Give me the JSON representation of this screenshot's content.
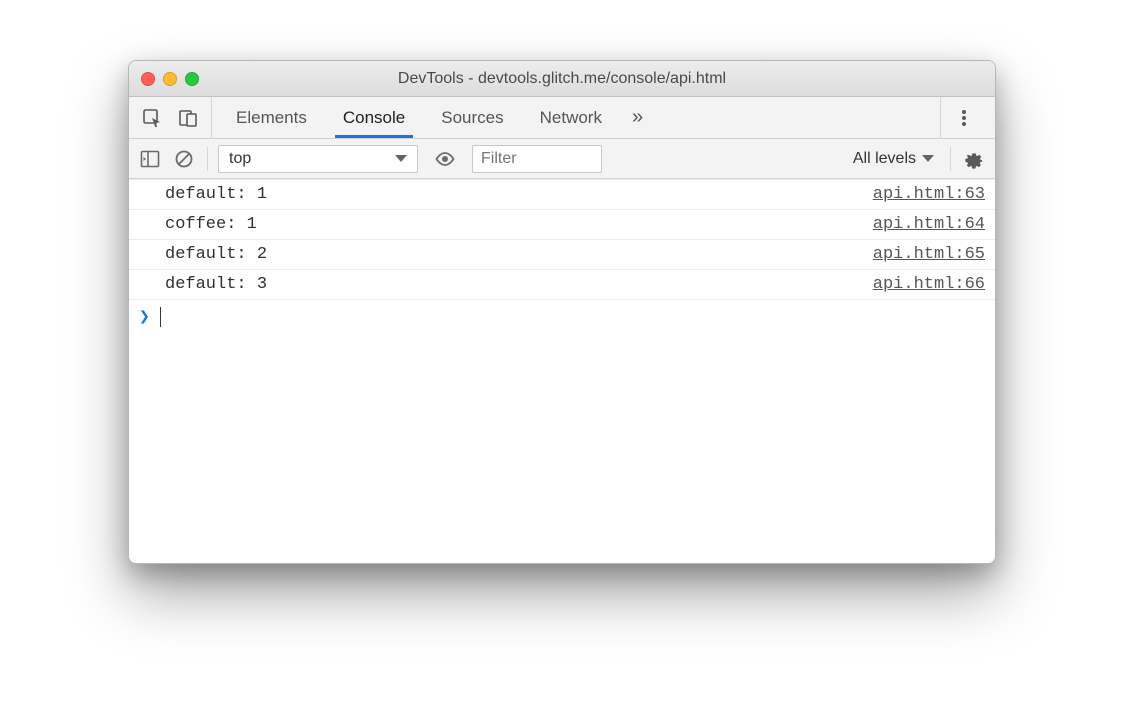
{
  "window": {
    "title": "DevTools - devtools.glitch.me/console/api.html"
  },
  "tabs": {
    "items": [
      "Elements",
      "Console",
      "Sources",
      "Network"
    ],
    "active_index": 1,
    "overflow_glyph": "»"
  },
  "console_toolbar": {
    "context": "top",
    "filter_placeholder": "Filter",
    "levels_label": "All levels"
  },
  "logs": [
    {
      "message": "default: 1",
      "source": "api.html:63"
    },
    {
      "message": "coffee: 1",
      "source": "api.html:64"
    },
    {
      "message": "default: 2",
      "source": "api.html:65"
    },
    {
      "message": "default: 3",
      "source": "api.html:66"
    }
  ],
  "prompt": {
    "glyph": "❯"
  }
}
